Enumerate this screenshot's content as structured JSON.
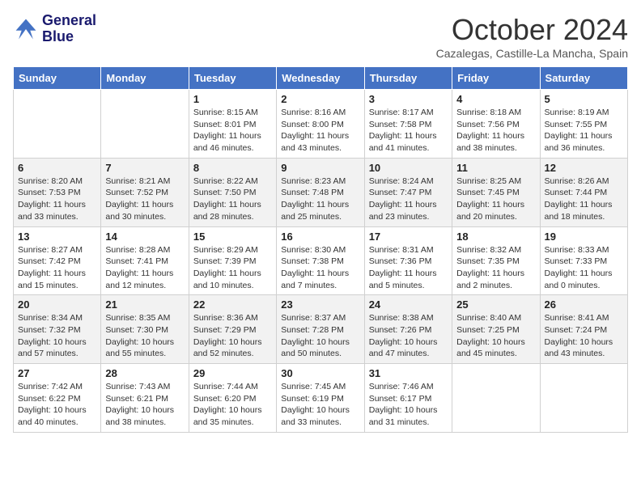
{
  "header": {
    "logo_line1": "General",
    "logo_line2": "Blue",
    "month_title": "October 2024",
    "subtitle": "Cazalegas, Castille-La Mancha, Spain"
  },
  "days_of_week": [
    "Sunday",
    "Monday",
    "Tuesday",
    "Wednesday",
    "Thursday",
    "Friday",
    "Saturday"
  ],
  "weeks": [
    [
      {
        "day": "",
        "info": ""
      },
      {
        "day": "",
        "info": ""
      },
      {
        "day": "1",
        "info": "Sunrise: 8:15 AM\nSunset: 8:01 PM\nDaylight: 11 hours and 46 minutes."
      },
      {
        "day": "2",
        "info": "Sunrise: 8:16 AM\nSunset: 8:00 PM\nDaylight: 11 hours and 43 minutes."
      },
      {
        "day": "3",
        "info": "Sunrise: 8:17 AM\nSunset: 7:58 PM\nDaylight: 11 hours and 41 minutes."
      },
      {
        "day": "4",
        "info": "Sunrise: 8:18 AM\nSunset: 7:56 PM\nDaylight: 11 hours and 38 minutes."
      },
      {
        "day": "5",
        "info": "Sunrise: 8:19 AM\nSunset: 7:55 PM\nDaylight: 11 hours and 36 minutes."
      }
    ],
    [
      {
        "day": "6",
        "info": "Sunrise: 8:20 AM\nSunset: 7:53 PM\nDaylight: 11 hours and 33 minutes."
      },
      {
        "day": "7",
        "info": "Sunrise: 8:21 AM\nSunset: 7:52 PM\nDaylight: 11 hours and 30 minutes."
      },
      {
        "day": "8",
        "info": "Sunrise: 8:22 AM\nSunset: 7:50 PM\nDaylight: 11 hours and 28 minutes."
      },
      {
        "day": "9",
        "info": "Sunrise: 8:23 AM\nSunset: 7:48 PM\nDaylight: 11 hours and 25 minutes."
      },
      {
        "day": "10",
        "info": "Sunrise: 8:24 AM\nSunset: 7:47 PM\nDaylight: 11 hours and 23 minutes."
      },
      {
        "day": "11",
        "info": "Sunrise: 8:25 AM\nSunset: 7:45 PM\nDaylight: 11 hours and 20 minutes."
      },
      {
        "day": "12",
        "info": "Sunrise: 8:26 AM\nSunset: 7:44 PM\nDaylight: 11 hours and 18 minutes."
      }
    ],
    [
      {
        "day": "13",
        "info": "Sunrise: 8:27 AM\nSunset: 7:42 PM\nDaylight: 11 hours and 15 minutes."
      },
      {
        "day": "14",
        "info": "Sunrise: 8:28 AM\nSunset: 7:41 PM\nDaylight: 11 hours and 12 minutes."
      },
      {
        "day": "15",
        "info": "Sunrise: 8:29 AM\nSunset: 7:39 PM\nDaylight: 11 hours and 10 minutes."
      },
      {
        "day": "16",
        "info": "Sunrise: 8:30 AM\nSunset: 7:38 PM\nDaylight: 11 hours and 7 minutes."
      },
      {
        "day": "17",
        "info": "Sunrise: 8:31 AM\nSunset: 7:36 PM\nDaylight: 11 hours and 5 minutes."
      },
      {
        "day": "18",
        "info": "Sunrise: 8:32 AM\nSunset: 7:35 PM\nDaylight: 11 hours and 2 minutes."
      },
      {
        "day": "19",
        "info": "Sunrise: 8:33 AM\nSunset: 7:33 PM\nDaylight: 11 hours and 0 minutes."
      }
    ],
    [
      {
        "day": "20",
        "info": "Sunrise: 8:34 AM\nSunset: 7:32 PM\nDaylight: 10 hours and 57 minutes."
      },
      {
        "day": "21",
        "info": "Sunrise: 8:35 AM\nSunset: 7:30 PM\nDaylight: 10 hours and 55 minutes."
      },
      {
        "day": "22",
        "info": "Sunrise: 8:36 AM\nSunset: 7:29 PM\nDaylight: 10 hours and 52 minutes."
      },
      {
        "day": "23",
        "info": "Sunrise: 8:37 AM\nSunset: 7:28 PM\nDaylight: 10 hours and 50 minutes."
      },
      {
        "day": "24",
        "info": "Sunrise: 8:38 AM\nSunset: 7:26 PM\nDaylight: 10 hours and 47 minutes."
      },
      {
        "day": "25",
        "info": "Sunrise: 8:40 AM\nSunset: 7:25 PM\nDaylight: 10 hours and 45 minutes."
      },
      {
        "day": "26",
        "info": "Sunrise: 8:41 AM\nSunset: 7:24 PM\nDaylight: 10 hours and 43 minutes."
      }
    ],
    [
      {
        "day": "27",
        "info": "Sunrise: 7:42 AM\nSunset: 6:22 PM\nDaylight: 10 hours and 40 minutes."
      },
      {
        "day": "28",
        "info": "Sunrise: 7:43 AM\nSunset: 6:21 PM\nDaylight: 10 hours and 38 minutes."
      },
      {
        "day": "29",
        "info": "Sunrise: 7:44 AM\nSunset: 6:20 PM\nDaylight: 10 hours and 35 minutes."
      },
      {
        "day": "30",
        "info": "Sunrise: 7:45 AM\nSunset: 6:19 PM\nDaylight: 10 hours and 33 minutes."
      },
      {
        "day": "31",
        "info": "Sunrise: 7:46 AM\nSunset: 6:17 PM\nDaylight: 10 hours and 31 minutes."
      },
      {
        "day": "",
        "info": ""
      },
      {
        "day": "",
        "info": ""
      }
    ]
  ]
}
